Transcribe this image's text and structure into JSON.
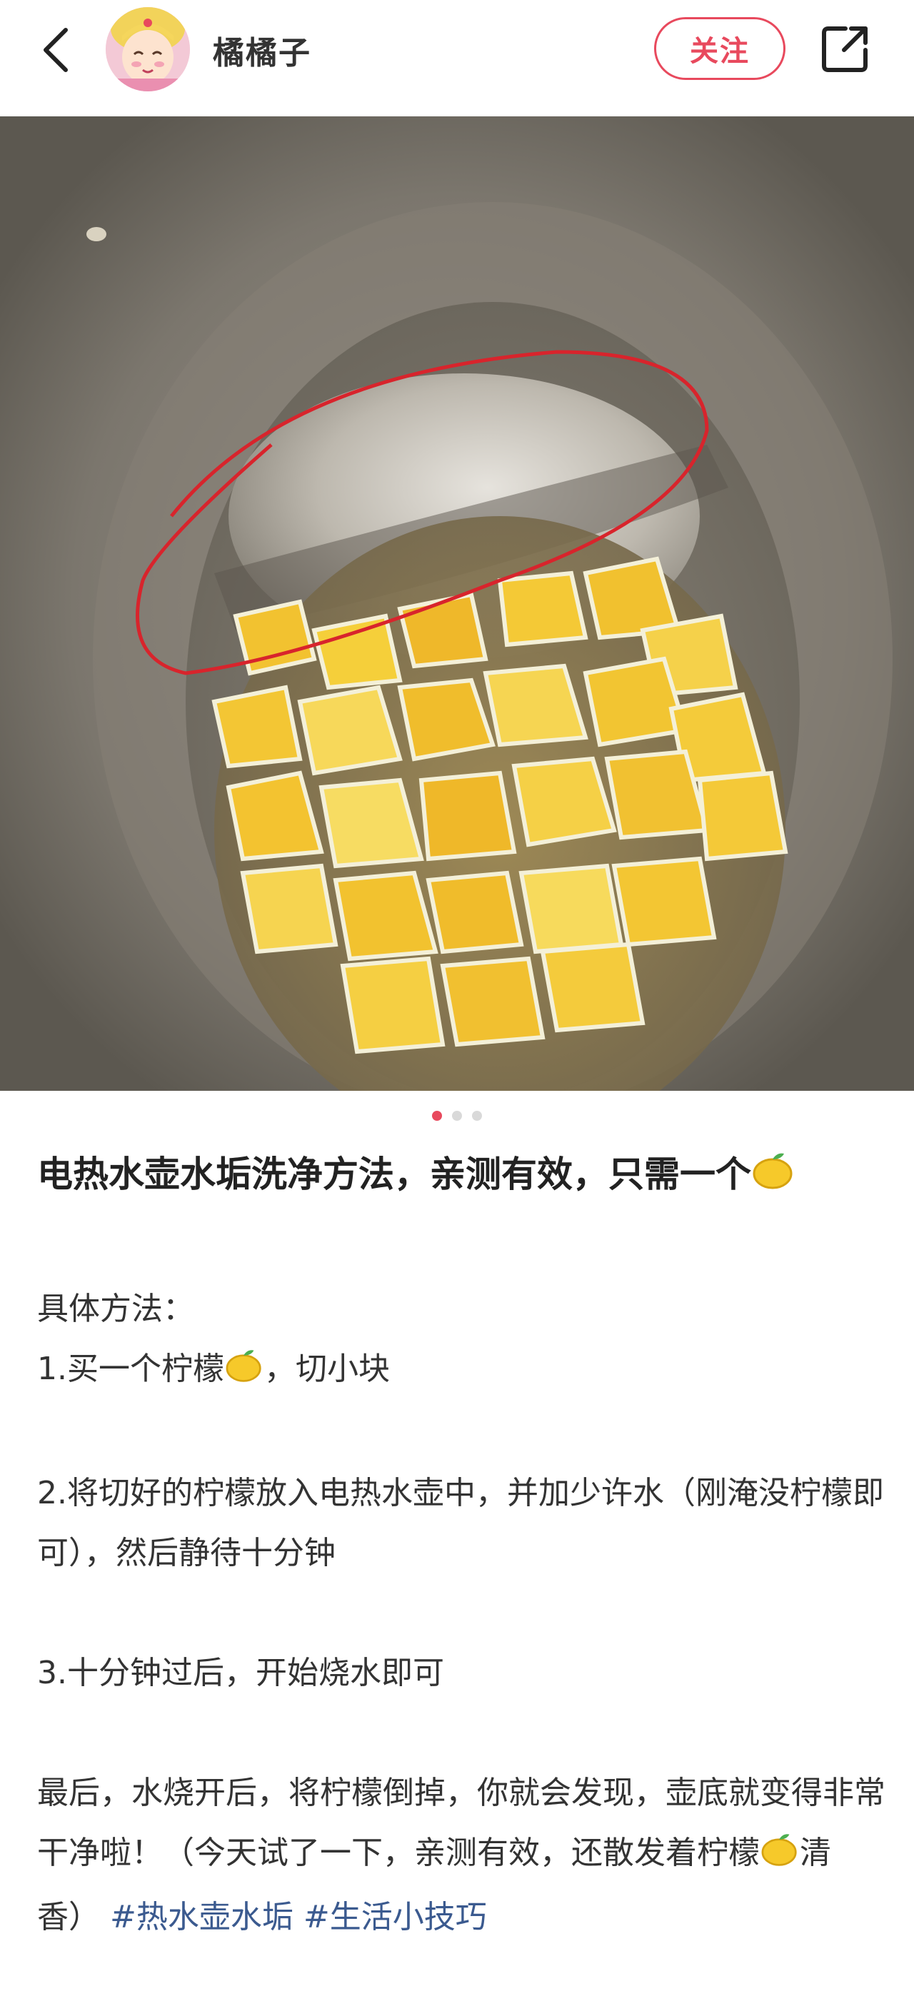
{
  "header": {
    "author_name": "橘橘子",
    "follow_label": "关注"
  },
  "icons": {
    "back": "chevron-left-icon",
    "share": "share-icon",
    "lemon": "lemon-emoji-icon"
  },
  "carousel": {
    "total": 3,
    "active_index": 0
  },
  "post": {
    "title": "电热水壶水垢洗净方法，亲测有效，只需一个",
    "intro": "具体方法：",
    "step1_a": "1.买一个柠檬",
    "step1_b": "，切小块",
    "step2": "2.将切好的柠檬放入电热水壶中，并加少许水（刚淹没柠檬即可），然后静待十分钟",
    "step3": "3.十分钟过后，开始烧水即可",
    "final_a": "最后，水烧开后，将柠檬倒掉，你就会发现，壶底就变得非常干净啦！（今天试了一下，亲测有效，还散发着柠檬",
    "final_b": "清香）",
    "tags": [
      "#热水壶水垢",
      "#生活小技巧"
    ]
  },
  "colors": {
    "accent": "#e8495d",
    "tag": "#3b5a8f"
  }
}
